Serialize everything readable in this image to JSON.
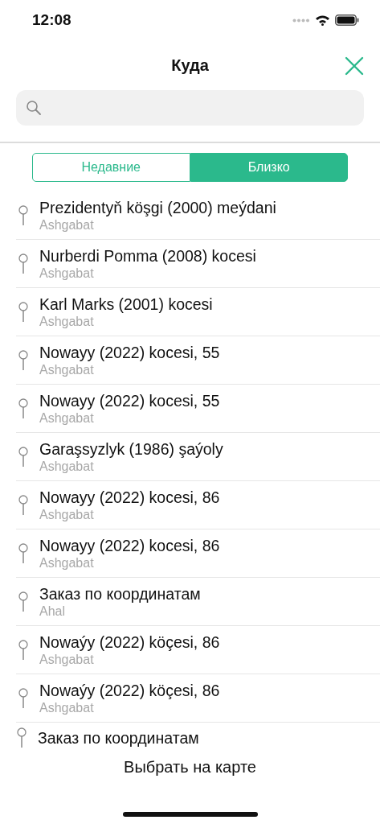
{
  "status_bar": {
    "time": "12:08"
  },
  "header": {
    "title": "Куда"
  },
  "tabs": [
    {
      "label": "Недавние",
      "selected": false
    },
    {
      "label": "Близко",
      "selected": true
    }
  ],
  "places": [
    {
      "name": "Prezidentyň köşgi (2000) meýdani",
      "city": "Ashgabat"
    },
    {
      "name": "Nurberdi Pomma (2008) kocesi",
      "city": "Ashgabat"
    },
    {
      "name": "Karl Marks (2001) kocesi",
      "city": "Ashgabat"
    },
    {
      "name": "Nowayy (2022) kocesi, 55",
      "city": "Ashgabat"
    },
    {
      "name": "Nowayy (2022) kocesi, 55",
      "city": "Ashgabat"
    },
    {
      "name": "Garaşsyzlyk (1986) şaýoly",
      "city": "Ashgabat"
    },
    {
      "name": "Nowayy (2022) kocesi, 86",
      "city": "Ashgabat"
    },
    {
      "name": "Nowayy (2022) kocesi, 86",
      "city": "Ashgabat"
    },
    {
      "name": "Заказ по координатам",
      "city": "Ahal"
    },
    {
      "name": "Nowaýy (2022) köçesi, 86",
      "city": "Ashgabat"
    },
    {
      "name": "Nowaýy (2022) köçesi, 86",
      "city": "Ashgabat"
    },
    {
      "name": "Заказ по координатам"
    }
  ],
  "map_button": {
    "label": "Выбрать на карте"
  }
}
